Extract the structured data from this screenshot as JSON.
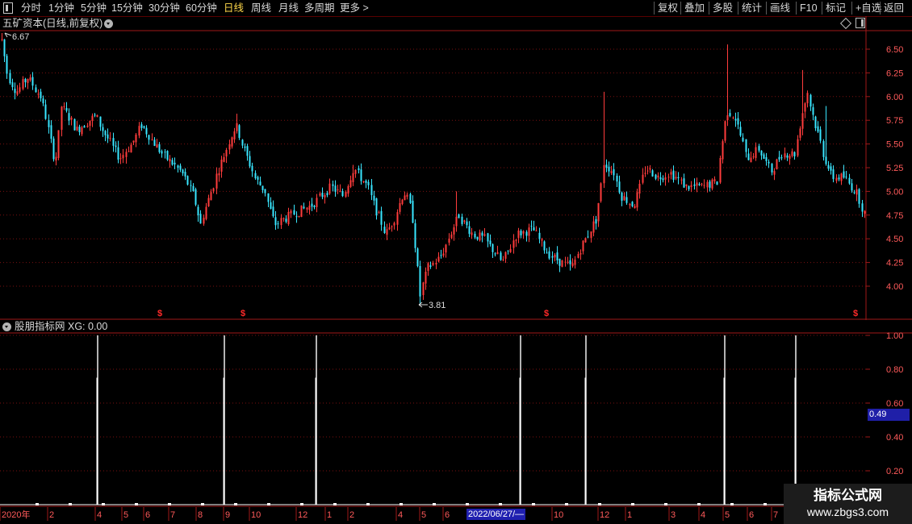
{
  "toolbar": {
    "left_items": [
      "分时",
      "1分钟",
      "5分钟",
      "15分钟",
      "30分钟",
      "60分钟",
      "日线",
      "周线",
      "月线",
      "多周期",
      "更多 >"
    ],
    "active_index": 6,
    "right_items": [
      "复权",
      "叠加",
      "多股",
      "统计",
      "画线",
      "F10",
      "标记",
      "+自选",
      "返回"
    ]
  },
  "main_chart": {
    "title": "五矿资本(日线,前复权)",
    "high_label": "6.67",
    "low_label": "3.81",
    "y_ticks": [
      "6.50",
      "6.25",
      "6.00",
      "5.75",
      "5.50",
      "5.25",
      "5.00",
      "4.75",
      "4.50",
      "4.25",
      "4.00"
    ],
    "signal_marker": "$",
    "signal_positions": [
      198,
      301,
      677,
      1060
    ],
    "colors": {
      "up": "#ff3c3c",
      "down": "#39e6ff",
      "grid": "#7a1010",
      "border": "#a01818",
      "axis": "#ff5a5a"
    }
  },
  "indicator": {
    "title": "股朋指标网",
    "readout": "XG: 0.00",
    "y_ticks": [
      "1.00",
      "0.80",
      "0.60",
      "0.40",
      "0.20"
    ],
    "current_value": "0.49",
    "spike_positions": [
      121,
      278,
      392,
      645,
      726,
      898,
      986
    ]
  },
  "date_axis": {
    "labels": [
      "2020年",
      "2",
      "4",
      "5",
      "6",
      "7",
      "8",
      "9",
      "10",
      "12",
      "1",
      "2",
      "4",
      "5",
      "6",
      "10",
      "12",
      "1",
      "3",
      "4",
      "5",
      "6",
      "7"
    ],
    "highlight": "2022/06/27/—"
  },
  "watermark": {
    "line1": "指标公式网",
    "line2": "www.zbgs3.com"
  }
}
